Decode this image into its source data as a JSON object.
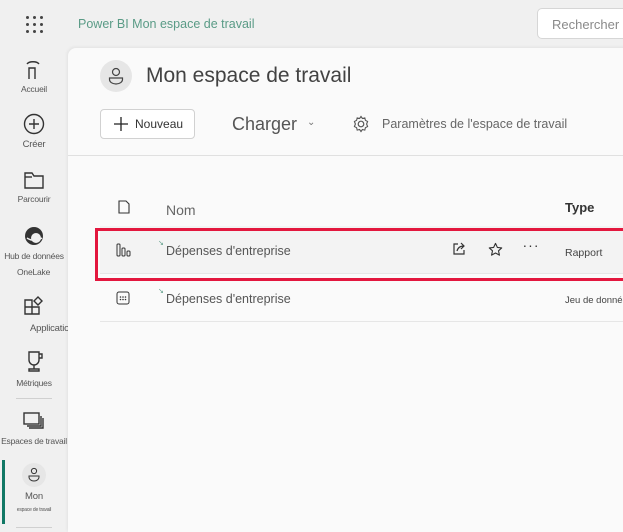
{
  "topbar": {
    "app_title": "Power BI Mon espace de travail",
    "search_placeholder": "Rechercher",
    "waffle_icon": "app-launcher-icon"
  },
  "sidebar": {
    "items": [
      {
        "label": "Accueil",
        "icon": "home-icon"
      },
      {
        "label": "Créer",
        "icon": "plus-circle-icon"
      },
      {
        "label": "Parcourir",
        "icon": "folder-icon"
      },
      {
        "label": "Hub de données",
        "label2": "OneLake",
        "icon": "onelake-icon"
      },
      {
        "label": "Applications",
        "icon": "apps-icon"
      },
      {
        "label": "Métriques",
        "icon": "trophy-icon"
      },
      {
        "label": "Espaces de travail",
        "icon": "workspaces-icon"
      },
      {
        "label": "Mon",
        "label2": "espace de travail",
        "icon": "person-icon",
        "active": true
      }
    ],
    "accent_color": "#117865"
  },
  "workspace": {
    "title": "Mon espace de travail",
    "new_button": "Nouveau",
    "upload_button": "Charger",
    "settings_button": "Paramètres de l'espace de travail"
  },
  "table": {
    "columns": {
      "name": "Nom",
      "type": "Type"
    },
    "rows": [
      {
        "name": "Dépenses d'entreprise",
        "type": "Rapport",
        "icon": "report-icon",
        "selected": true
      },
      {
        "name": "Dépenses d'entreprise",
        "type": "Jeu de données",
        "icon": "dataset-icon",
        "selected": false
      }
    ]
  },
  "highlight_color": "#e3173e"
}
